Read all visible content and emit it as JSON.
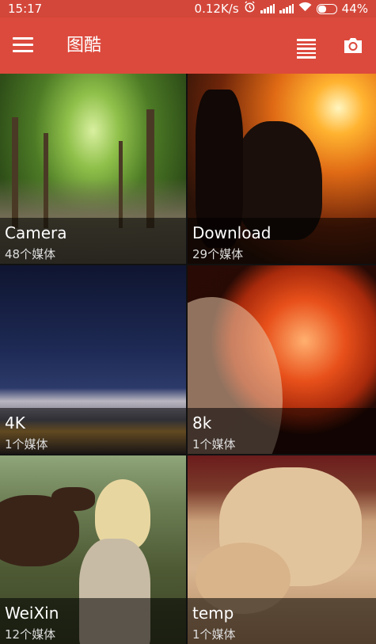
{
  "status_bar": {
    "time": "15:17",
    "network_speed": "0.12K/s",
    "alarm_icon": "alarm-clock-icon",
    "signal_icons": [
      "signal-icon",
      "signal-hd-icon"
    ],
    "wifi_icon": "wifi-icon",
    "battery_percent": "44%",
    "battery_level": 0.44
  },
  "toolbar": {
    "title": "图酷",
    "menu_icon": "hamburger-menu-icon",
    "list_icon": "list-view-icon",
    "camera_icon": "camera-icon",
    "color": "#dc4a3d"
  },
  "albums": [
    {
      "name": "Camera",
      "count": "48个媒体"
    },
    {
      "name": "Download",
      "count": "29个媒体"
    },
    {
      "name": "4K",
      "count": "1个媒体"
    },
    {
      "name": "8k",
      "count": "1个媒体"
    },
    {
      "name": "WeiXin",
      "count": "12个媒体"
    },
    {
      "name": "temp",
      "count": "1个媒体"
    }
  ]
}
